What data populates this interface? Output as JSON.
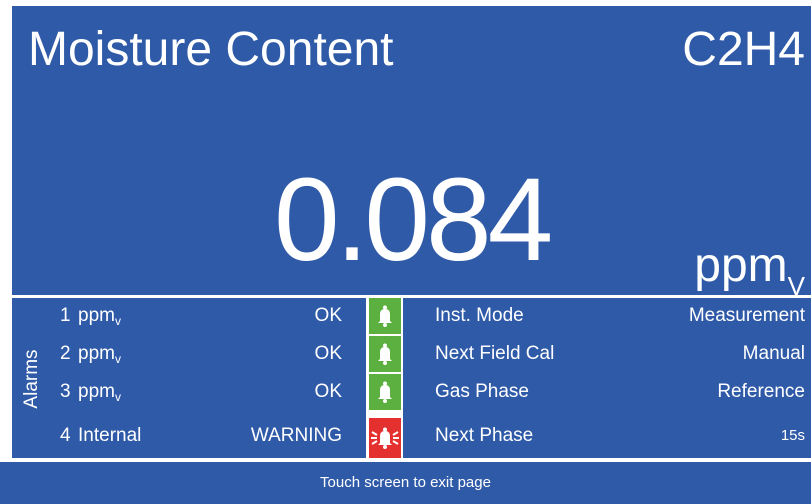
{
  "header": {
    "title": "Moisture Content",
    "gas": "C2H4"
  },
  "reading": {
    "value": "0.084",
    "unit_main": "ppm",
    "unit_sub": "V"
  },
  "alarms": {
    "label": "Alarms",
    "rows": [
      {
        "num": "1",
        "name": "ppm",
        "sub": "v",
        "state": "OK",
        "bell": "ok"
      },
      {
        "num": "2",
        "name": "ppm",
        "sub": "v",
        "state": "OK",
        "bell": "ok"
      },
      {
        "num": "3",
        "name": "ppm",
        "sub": "v",
        "state": "OK",
        "bell": "ok"
      },
      {
        "num": "4",
        "name": "Internal",
        "sub": "",
        "state": "WARNING",
        "bell": "warn"
      }
    ]
  },
  "info": {
    "rows": [
      {
        "label": "Inst. Mode",
        "value": "Measurement"
      },
      {
        "label": "Next Field Cal",
        "value": "Manual"
      },
      {
        "label": "Gas Phase",
        "value": "Reference"
      },
      {
        "label": "Next Phase",
        "value": "15s"
      }
    ]
  },
  "footer": {
    "text": "Touch screen to exit page"
  },
  "colors": {
    "panel": "#2f5aa8",
    "bell_ok": "#5cb040",
    "bell_warn": "#e53030"
  },
  "icons": {
    "bell_ok": "bell-icon",
    "bell_warn": "bell-alarm-icon"
  }
}
